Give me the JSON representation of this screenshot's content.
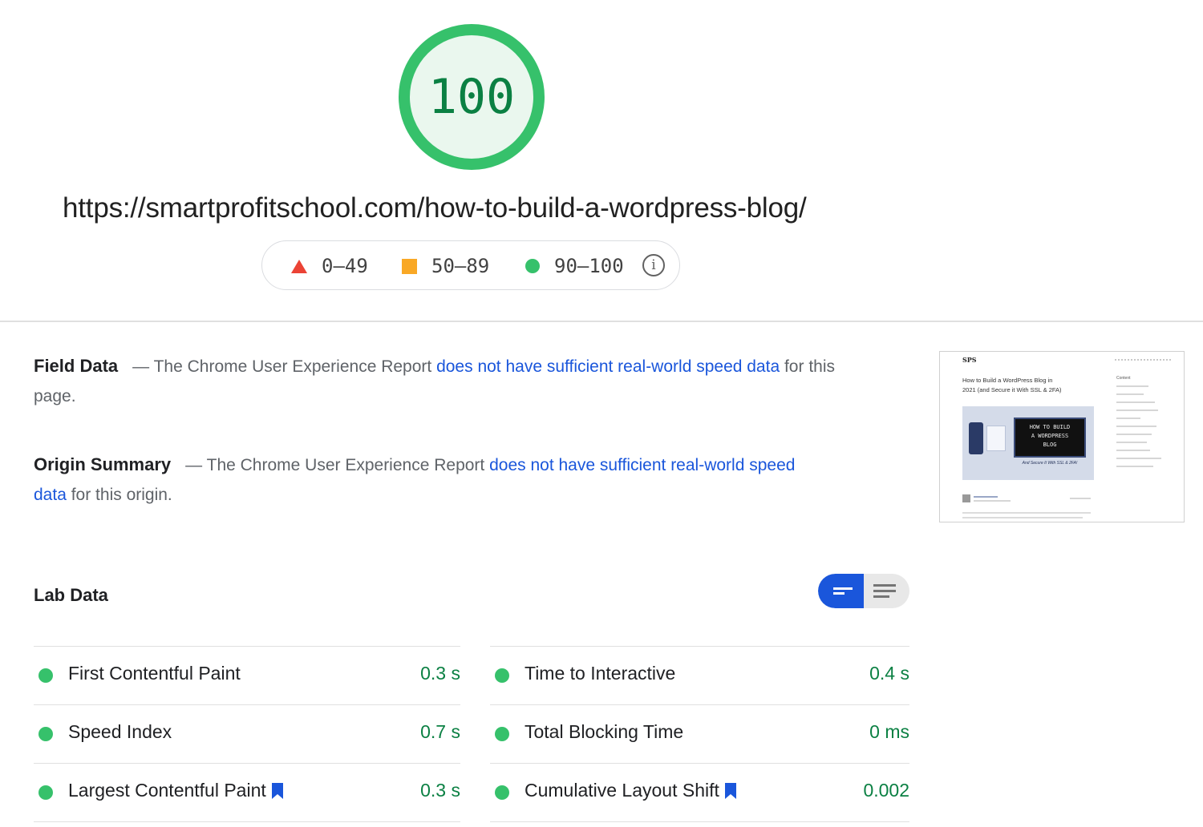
{
  "score": {
    "value": "100",
    "color": "#36c16b",
    "fill": "#eaf7ee"
  },
  "url": "https://smartprofitschool.com/how-to-build-a-wordpress-blog/",
  "legend": [
    {
      "shape": "triangle",
      "color": "#eb4335",
      "range": "0–49"
    },
    {
      "shape": "square",
      "color": "#f9a825",
      "range": "50–89"
    },
    {
      "shape": "circle",
      "color": "#36c16b",
      "range": "90–100"
    }
  ],
  "field_data": {
    "heading": "Field Data",
    "prefix": "— The Chrome User Experience Report ",
    "link": "does not have sufficient real-world speed data",
    "suffix": " for this page."
  },
  "origin_summary": {
    "heading": "Origin Summary",
    "prefix": "— The Chrome User Experience Report ",
    "link": "does not have sufficient real-world speed data",
    "suffix": " for this origin."
  },
  "thumbnail": {
    "logo": "SPS",
    "title_line1": "How to Build a WordPress Blog in",
    "title_line2": "2021 (and Secure it With SSL & 2FA)",
    "image_line1": "HOW TO BUILD",
    "image_line2": "A WORDPRESS",
    "image_line3": "BLOG",
    "caption": "And Secure It With SSL & 2FA!",
    "sidebar_heading": "Content"
  },
  "lab_data": {
    "title": "Lab Data",
    "left": [
      {
        "label": "First Contentful Paint",
        "value": "0.3 s",
        "bookmark": false
      },
      {
        "label": "Speed Index",
        "value": "0.7 s",
        "bookmark": false
      },
      {
        "label": "Largest Contentful Paint",
        "value": "0.3 s",
        "bookmark": true
      }
    ],
    "right": [
      {
        "label": "Time to Interactive",
        "value": "0.4 s",
        "bookmark": false
      },
      {
        "label": "Total Blocking Time",
        "value": "0 ms",
        "bookmark": false
      },
      {
        "label": "Cumulative Layout Shift",
        "value": "0.002",
        "bookmark": true
      }
    ]
  },
  "colors": {
    "accent": "#1a56db",
    "pass": "#36c16b",
    "pass_text": "#0b8043"
  }
}
